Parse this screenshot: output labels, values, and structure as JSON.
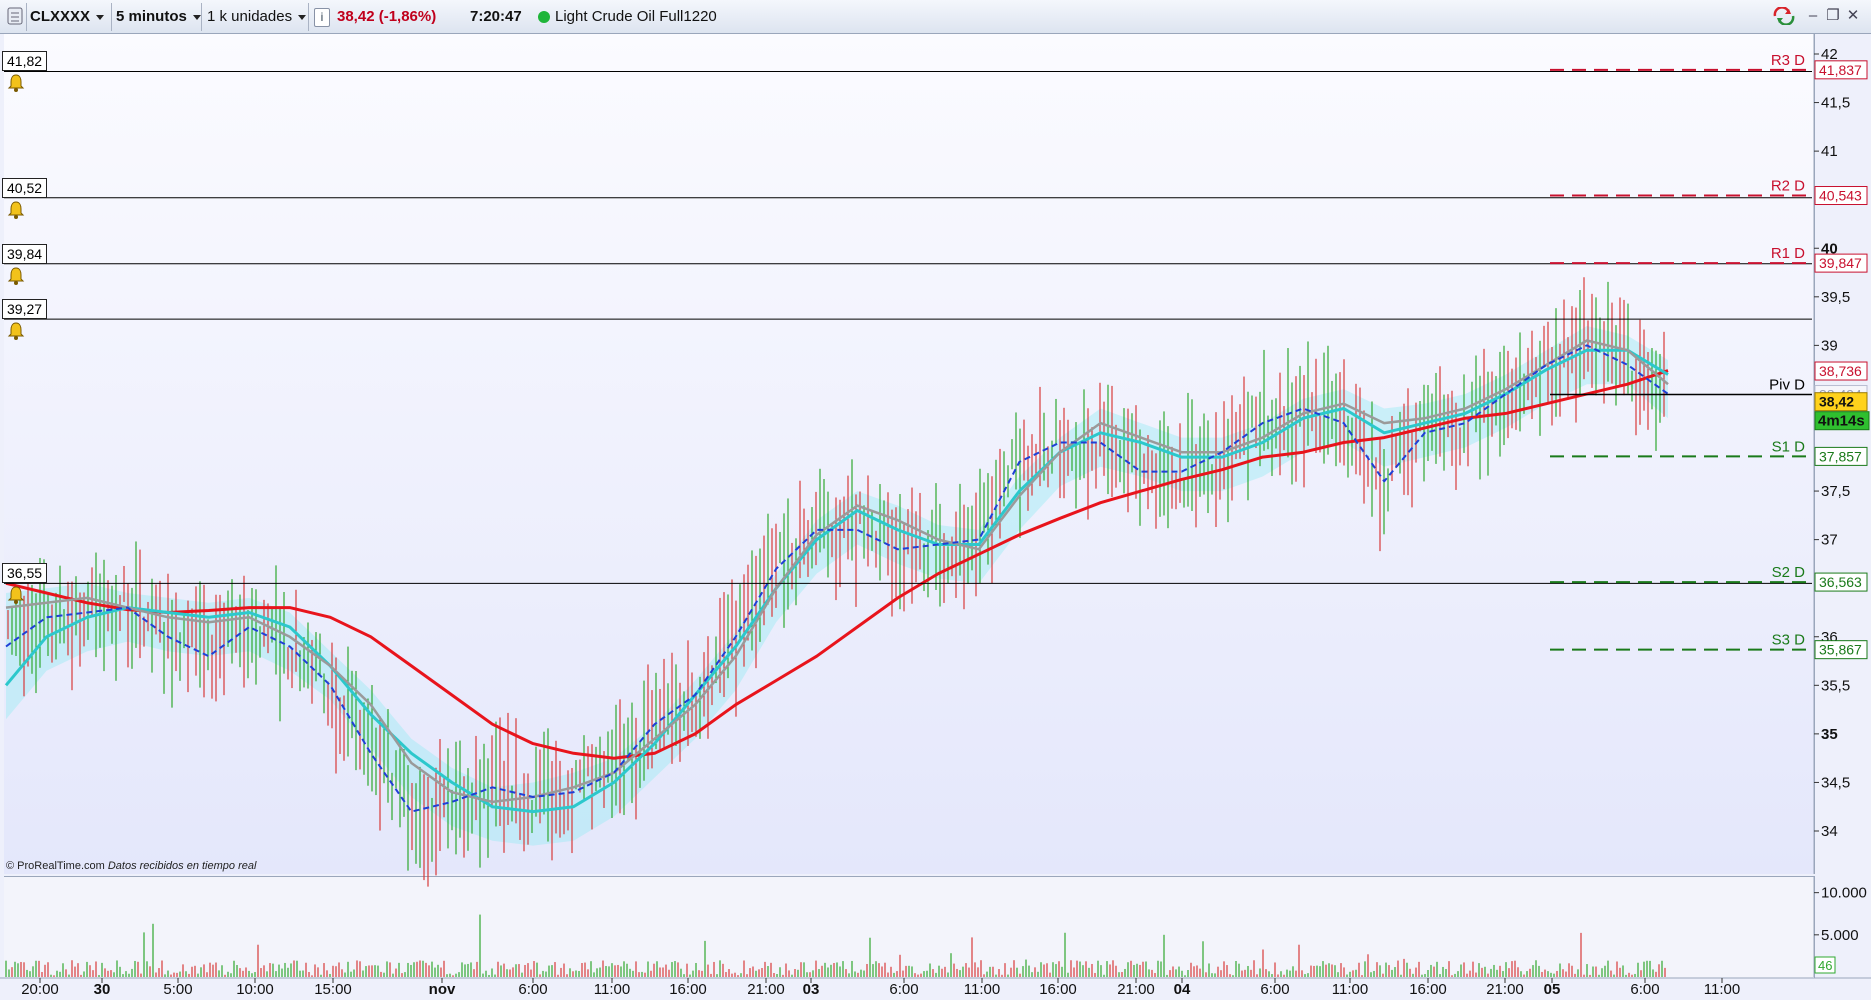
{
  "toolbar": {
    "symbol": "CLXXXX",
    "timeframe": "5 minutos",
    "units": "1 k unidades",
    "quote": "38,42 (-1,86%)",
    "time": "7:20:47",
    "instrument": "Light Crude Oil Full1220"
  },
  "credit": {
    "source": "© ProRealTime.com",
    "note": "Datos recibidos en tiempo real"
  },
  "alerts": [
    "41,82",
    "40,52",
    "39,84",
    "39,27",
    "36,55"
  ],
  "price_axis": {
    "ticks": [
      "42",
      "41,5",
      "41",
      "40",
      "39,5",
      "39",
      "37,5",
      "37",
      "36",
      "35,5",
      "35",
      "34,5",
      "34"
    ],
    "bold_ticks": [
      "40",
      "35"
    ],
    "tags": {
      "r3": "41,837",
      "r2": "40,543",
      "r1": "39,847",
      "ma": "38,736",
      "piv": "38,494",
      "last": "38,42",
      "countdown": "4m14s",
      "s1": "37,857",
      "s2": "36,563",
      "s3": "35,867"
    }
  },
  "volume_axis": {
    "ticks": [
      "10.000",
      "5.000"
    ],
    "last": "46"
  },
  "time_axis": {
    "labels": [
      "20:00",
      "30",
      "5:00",
      "10:00",
      "15:00",
      "nov",
      "6:00",
      "11:00",
      "16:00",
      "21:00",
      "03",
      "6:00",
      "11:00",
      "16:00",
      "21:00",
      "04",
      "6:00",
      "11:00",
      "16:00",
      "21:00",
      "05",
      "6:00",
      "11:00"
    ],
    "bold_labels": [
      "30",
      "nov",
      "03",
      "04",
      "05"
    ]
  },
  "pivots": [
    {
      "label": "R3 D",
      "value": 41.837,
      "color": "#c8102e"
    },
    {
      "label": "R2 D",
      "value": 40.543,
      "color": "#c8102e"
    },
    {
      "label": "R1 D",
      "value": 39.847,
      "color": "#c8102e"
    },
    {
      "label": "Piv D",
      "value": 38.494,
      "color": "#000000"
    },
    {
      "label": "S1 D",
      "value": 37.857,
      "color": "#1a7a1a"
    },
    {
      "label": "S2 D",
      "value": 36.563,
      "color": "#1a7a1a"
    },
    {
      "label": "S3 D",
      "value": 35.867,
      "color": "#1a7a1a"
    }
  ],
  "colors": {
    "red_ma": "#e8141c",
    "cyan_ma": "#2cc8cc",
    "gray_ma": "#9a9a9a",
    "kijun": "#1f3fd6",
    "cloud": "#9cecf4",
    "up": "#2fa82f",
    "down": "#d83a3a",
    "last_tag": "#ffd21c",
    "countdown_tag": "#2fbf2f"
  },
  "chart_data": {
    "type": "line",
    "title": "Light Crude Oil Full1220",
    "ylim": [
      33.7,
      42.1
    ],
    "grid": false,
    "last_price": 38.42,
    "series": [
      {
        "name": "",
        "color": "#e8141c",
        "values": [
          36.55,
          36.45,
          36.35,
          36.28,
          36.25,
          36.27,
          36.3,
          36.3,
          36.2,
          36.0,
          35.7,
          35.4,
          35.1,
          34.9,
          34.8,
          34.75,
          34.8,
          35.0,
          35.3,
          35.55,
          35.8,
          36.1,
          36.4,
          36.65,
          36.85,
          37.05,
          37.22,
          37.38,
          37.5,
          37.62,
          37.72,
          37.85,
          37.9,
          38.0,
          38.05,
          38.15,
          38.25,
          38.3,
          38.4,
          38.5,
          38.6,
          38.74
        ]
      },
      {
        "name": "",
        "color": "#2cc8cc",
        "values": [
          35.5,
          36.0,
          36.2,
          36.3,
          36.25,
          36.2,
          36.25,
          36.1,
          35.7,
          35.2,
          34.8,
          34.5,
          34.25,
          34.2,
          34.25,
          34.5,
          34.9,
          35.4,
          35.9,
          36.5,
          37.0,
          37.3,
          37.1,
          36.95,
          36.95,
          37.5,
          37.9,
          38.1,
          38.0,
          37.85,
          37.85,
          38.0,
          38.25,
          38.35,
          38.1,
          38.2,
          38.3,
          38.5,
          38.75,
          38.95,
          38.95,
          38.7
        ]
      },
      {
        "name": "",
        "color": "#9a9a9a",
        "values": [
          36.3,
          36.35,
          36.4,
          36.3,
          36.2,
          36.15,
          36.2,
          36.0,
          35.7,
          35.3,
          34.7,
          34.4,
          34.3,
          34.35,
          34.45,
          34.6,
          34.95,
          35.3,
          35.8,
          36.5,
          37.05,
          37.35,
          37.2,
          37.0,
          36.9,
          37.45,
          37.9,
          38.2,
          38.05,
          37.9,
          37.9,
          38.05,
          38.3,
          38.4,
          38.2,
          38.25,
          38.35,
          38.55,
          38.8,
          39.05,
          38.95,
          38.6
        ]
      },
      {
        "name": "",
        "color": "#1f3fd6",
        "values": [
          35.9,
          36.2,
          36.25,
          36.3,
          36.0,
          35.8,
          36.1,
          35.9,
          35.5,
          34.8,
          34.2,
          34.3,
          34.45,
          34.35,
          34.4,
          34.6,
          35.1,
          35.4,
          36.0,
          36.7,
          37.1,
          37.1,
          36.9,
          36.95,
          37.0,
          37.8,
          38.0,
          38.0,
          37.7,
          37.7,
          37.9,
          38.2,
          38.35,
          38.2,
          37.6,
          38.1,
          38.2,
          38.5,
          38.8,
          39.0,
          38.8,
          38.5
        ]
      }
    ]
  }
}
